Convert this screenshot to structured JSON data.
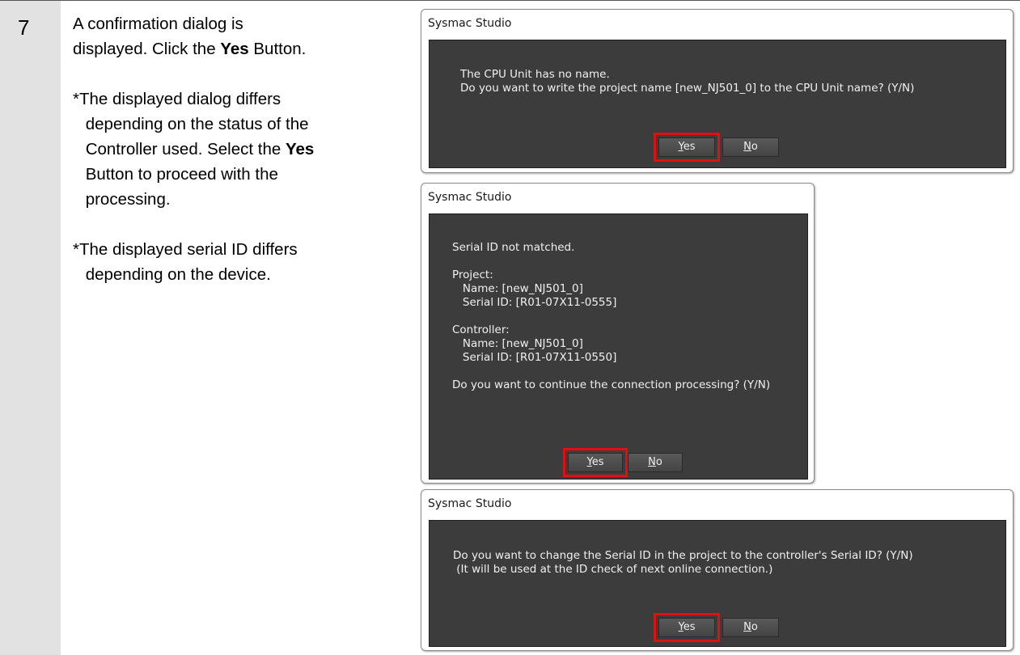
{
  "step": {
    "number": "7",
    "line1_a": "A confirmation dialog is",
    "line2_a": "displayed. Click the ",
    "line2_b": "Yes",
    "line2_c": " Button.",
    "note1_l1": "*The displayed dialog differs",
    "note1_l2": "depending on the status of the",
    "note1_l3a": "Controller used. Select the ",
    "note1_l3b": "Yes",
    "note1_l4": "Button to proceed with the",
    "note1_l5": "processing.",
    "note2_l1": "*The displayed serial ID differs",
    "note2_l2": "depending on the device."
  },
  "dialog1": {
    "title": "Sysmac Studio",
    "message": "The CPU Unit has no name.\nDo you want to write the project name [new_NJ501_0] to the CPU Unit name? (Y/N)",
    "yes_mnemonic": "Y",
    "yes_rest": "es",
    "no_mnemonic": "N",
    "no_rest": "o"
  },
  "dialog2": {
    "title": "Sysmac Studio",
    "message": "Serial ID not matched.\n\nProject:\n   Name: [new_NJ501_0]\n   Serial ID: [R01-07X11-0555]\n\nController:\n   Name: [new_NJ501_0]\n   Serial ID: [R01-07X11-0550]\n\nDo you want to continue the connection processing? (Y/N)",
    "yes_mnemonic": "Y",
    "yes_rest": "es",
    "no_mnemonic": "N",
    "no_rest": "o"
  },
  "dialog3": {
    "title": "Sysmac Studio",
    "message": "Do you want to change the Serial ID in the project to the controller's Serial ID? (Y/N)\n (It will be used at the ID check of next online connection.)",
    "yes_mnemonic": "Y",
    "yes_rest": "es",
    "no_mnemonic": "N",
    "no_rest": "o"
  },
  "colors": {
    "dialog_body": "#3c3c3c",
    "highlight": "#e01010",
    "step_column": "#e2e2e2"
  }
}
